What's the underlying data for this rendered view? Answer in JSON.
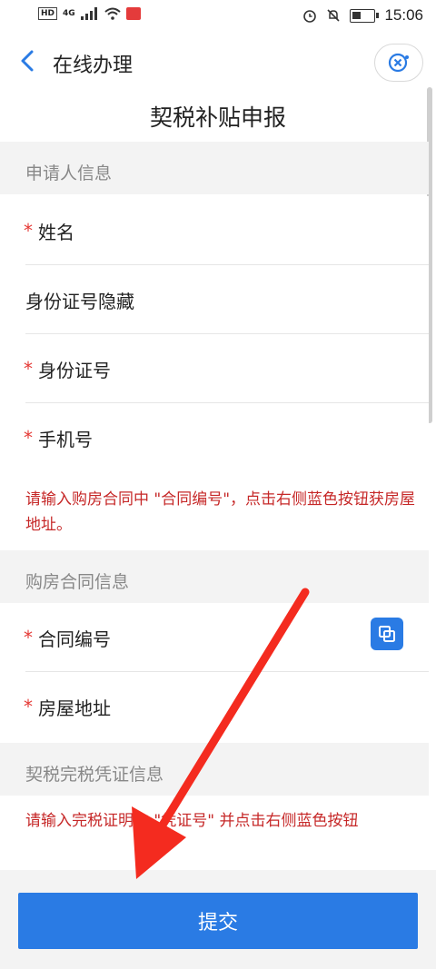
{
  "statusbar": {
    "network": "HD",
    "network_gen": "4G",
    "time": "15:06",
    "battery_percent": 40
  },
  "header": {
    "title": "在线办理"
  },
  "form": {
    "title": "契税补贴申报",
    "sections": {
      "applicant": "申请人信息",
      "contract": "购房合同信息",
      "certificate": "契税完税凭证信息"
    },
    "fields": {
      "name": "姓名",
      "id_hidden": "身份证号隐藏",
      "id_number": "身份证号",
      "phone": "手机号",
      "contract_no": "合同编号",
      "address": "房屋地址"
    },
    "required_mark": "*",
    "notice_contract": "请输入购房合同中 \"合同编号\"，点击右侧蓝色按钮获房屋地址。",
    "notice_certificate": "请输入完税证明中 \"凭证号\" 并点击右侧蓝色按钮"
  },
  "submit_label": "提交",
  "colors": {
    "accent": "#2a7be4",
    "required": "#e53935",
    "notice": "#c62828",
    "arrow": "#f42b1f"
  }
}
